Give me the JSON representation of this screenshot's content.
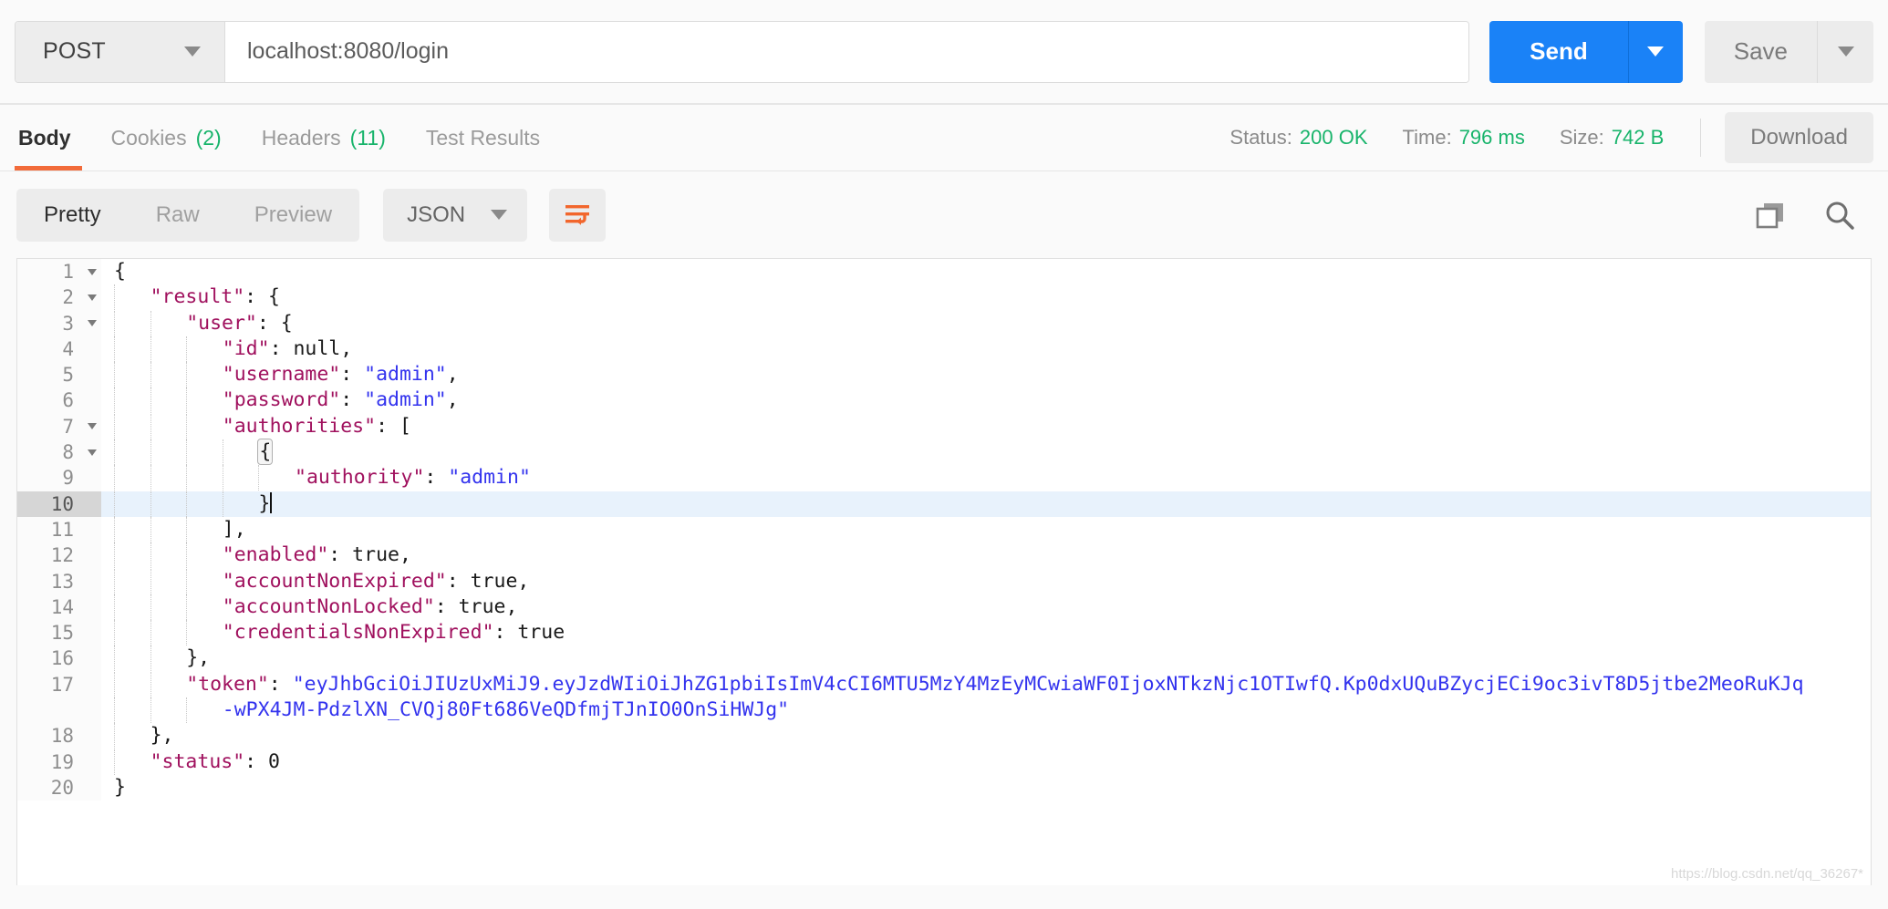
{
  "request": {
    "method": "POST",
    "url": "localhost:8080/login",
    "send_label": "Send",
    "save_label": "Save"
  },
  "response": {
    "tabs": [
      {
        "label": "Body",
        "count": "",
        "active": true
      },
      {
        "label": "Cookies",
        "count": "(2)",
        "active": false
      },
      {
        "label": "Headers",
        "count": "(11)",
        "active": false
      },
      {
        "label": "Test Results",
        "count": "",
        "active": false
      }
    ],
    "meta": {
      "status_label": "Status:",
      "status_value": "200 OK",
      "time_label": "Time:",
      "time_value": "796 ms",
      "size_label": "Size:",
      "size_value": "742 B"
    },
    "download_label": "Download"
  },
  "viewer": {
    "modes": [
      {
        "label": "Pretty",
        "active": true
      },
      {
        "label": "Raw",
        "active": false
      },
      {
        "label": "Preview",
        "active": false
      }
    ],
    "format": "JSON",
    "wrap_icon": "word-wrap-icon",
    "copy_icon": "copy-icon",
    "search_icon": "search-icon"
  },
  "colors": {
    "accent_blue": "#1a82f7",
    "accent_orange": "#f26b3a",
    "status_green": "#18b46b",
    "json_key": "#a0115e",
    "json_string": "#3333ee",
    "active_line": "#e8f2fc"
  },
  "body_json": {
    "lines": [
      {
        "n": "1",
        "fold": true,
        "indent": 0,
        "active": false,
        "tokens": [
          {
            "t": "{",
            "c": "p"
          }
        ]
      },
      {
        "n": "2",
        "fold": true,
        "indent": 1,
        "active": false,
        "tokens": [
          {
            "t": "\"result\"",
            "c": "k"
          },
          {
            "t": ": {",
            "c": "p"
          }
        ]
      },
      {
        "n": "3",
        "fold": true,
        "indent": 2,
        "active": false,
        "tokens": [
          {
            "t": "\"user\"",
            "c": "k"
          },
          {
            "t": ": {",
            "c": "p"
          }
        ]
      },
      {
        "n": "4",
        "fold": false,
        "indent": 3,
        "active": false,
        "tokens": [
          {
            "t": "\"id\"",
            "c": "k"
          },
          {
            "t": ": null,",
            "c": "p"
          }
        ]
      },
      {
        "n": "5",
        "fold": false,
        "indent": 3,
        "active": false,
        "tokens": [
          {
            "t": "\"username\"",
            "c": "k"
          },
          {
            "t": ": ",
            "c": "p"
          },
          {
            "t": "\"admin\"",
            "c": "s"
          },
          {
            "t": ",",
            "c": "p"
          }
        ]
      },
      {
        "n": "6",
        "fold": false,
        "indent": 3,
        "active": false,
        "tokens": [
          {
            "t": "\"password\"",
            "c": "k"
          },
          {
            "t": ": ",
            "c": "p"
          },
          {
            "t": "\"admin\"",
            "c": "s"
          },
          {
            "t": ",",
            "c": "p"
          }
        ]
      },
      {
        "n": "7",
        "fold": true,
        "indent": 3,
        "active": false,
        "tokens": [
          {
            "t": "\"authorities\"",
            "c": "k"
          },
          {
            "t": ": [",
            "c": "p"
          }
        ]
      },
      {
        "n": "8",
        "fold": true,
        "indent": 4,
        "active": false,
        "tokens": [
          {
            "t": "{",
            "c": "p",
            "hl": true
          }
        ]
      },
      {
        "n": "9",
        "fold": false,
        "indent": 5,
        "active": false,
        "tokens": [
          {
            "t": "\"authority\"",
            "c": "k"
          },
          {
            "t": ": ",
            "c": "p"
          },
          {
            "t": "\"admin\"",
            "c": "s"
          }
        ]
      },
      {
        "n": "10",
        "fold": false,
        "indent": 4,
        "active": true,
        "tokens": [
          {
            "t": "}",
            "c": "p"
          }
        ],
        "cursor": true
      },
      {
        "n": "11",
        "fold": false,
        "indent": 3,
        "active": false,
        "tokens": [
          {
            "t": "],",
            "c": "p"
          }
        ]
      },
      {
        "n": "12",
        "fold": false,
        "indent": 3,
        "active": false,
        "tokens": [
          {
            "t": "\"enabled\"",
            "c": "k"
          },
          {
            "t": ": true,",
            "c": "p"
          }
        ]
      },
      {
        "n": "13",
        "fold": false,
        "indent": 3,
        "active": false,
        "tokens": [
          {
            "t": "\"accountNonExpired\"",
            "c": "k"
          },
          {
            "t": ": true,",
            "c": "p"
          }
        ]
      },
      {
        "n": "14",
        "fold": false,
        "indent": 3,
        "active": false,
        "tokens": [
          {
            "t": "\"accountNonLocked\"",
            "c": "k"
          },
          {
            "t": ": true,",
            "c": "p"
          }
        ]
      },
      {
        "n": "15",
        "fold": false,
        "indent": 3,
        "active": false,
        "tokens": [
          {
            "t": "\"credentialsNonExpired\"",
            "c": "k"
          },
          {
            "t": ": true",
            "c": "p"
          }
        ]
      },
      {
        "n": "16",
        "fold": false,
        "indent": 2,
        "active": false,
        "tokens": [
          {
            "t": "},",
            "c": "p"
          }
        ]
      },
      {
        "n": "17",
        "fold": false,
        "indent": 2,
        "active": false,
        "tokens": [
          {
            "t": "\"token\"",
            "c": "k"
          },
          {
            "t": ": ",
            "c": "p"
          },
          {
            "t": "\"eyJhbGciOiJIUzUxMiJ9.eyJzdWIiOiJhZG1pbiIsImV4cCI6MTU5MzY4MzEyMCwiaWF0IjoxNTkzNjc1OTIwfQ.Kp0dxUQuBZycjECi9oc3ivT8D5jtbe2MeoRuKJq",
            "c": "s"
          }
        ]
      },
      {
        "n": "",
        "fold": false,
        "indent": 3,
        "active": false,
        "wrap": true,
        "tokens": [
          {
            "t": "-wPX4JM-PdzlXN_CVQj80Ft686VeQDfmjTJnIO0OnSiHWJg\"",
            "c": "s"
          }
        ]
      },
      {
        "n": "18",
        "fold": false,
        "indent": 1,
        "active": false,
        "tokens": [
          {
            "t": "},",
            "c": "p"
          }
        ]
      },
      {
        "n": "19",
        "fold": false,
        "indent": 1,
        "active": false,
        "tokens": [
          {
            "t": "\"status\"",
            "c": "k"
          },
          {
            "t": ": 0",
            "c": "p"
          }
        ]
      },
      {
        "n": "20",
        "fold": false,
        "indent": 0,
        "active": false,
        "tokens": [
          {
            "t": "}",
            "c": "p"
          }
        ]
      }
    ]
  }
}
